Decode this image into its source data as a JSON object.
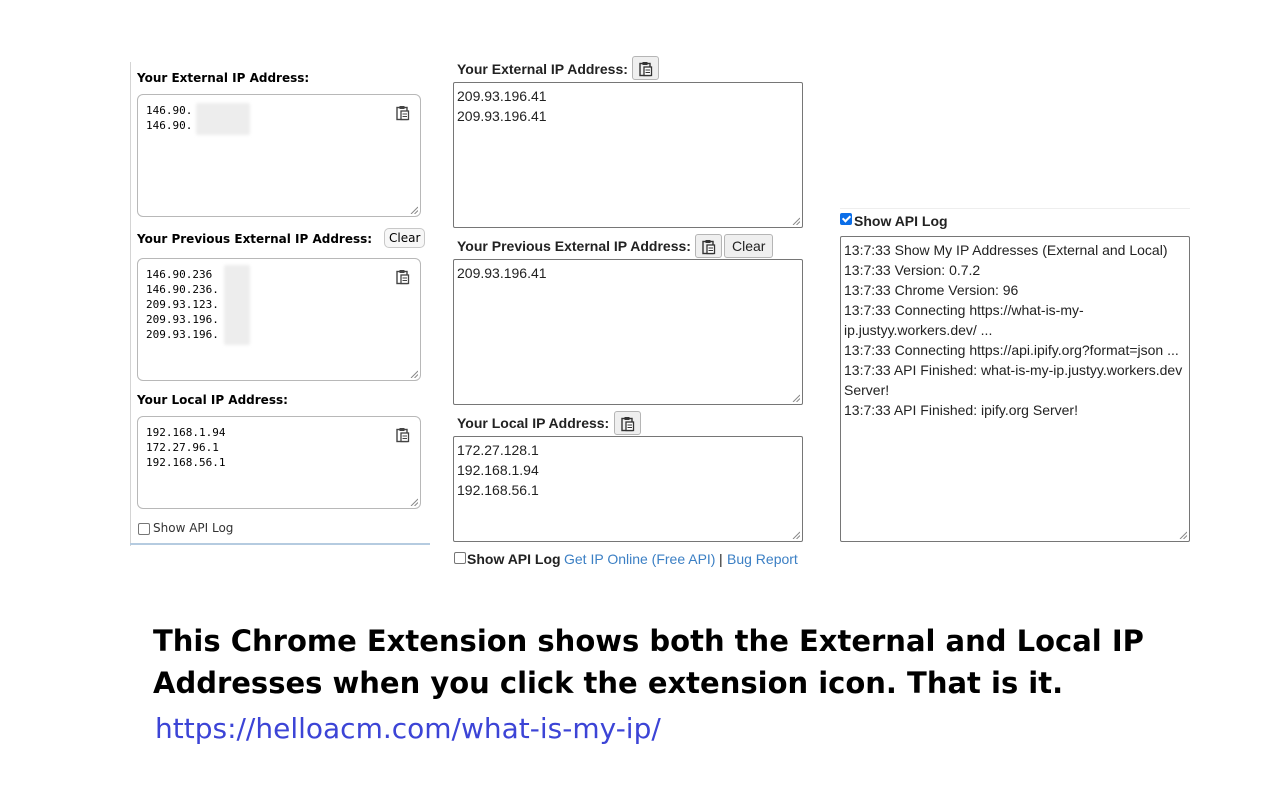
{
  "left_panel": {
    "external_label": "Your External IP Address:",
    "external_ips": [
      "146.90.",
      "146.90."
    ],
    "previous_label": "Your Previous External IP Address:",
    "clear_label": "Clear",
    "previous_ips": [
      "146.90.236",
      "146.90.236.",
      "209.93.123.",
      "209.93.196.",
      "209.93.196."
    ],
    "local_label": "Your Local IP Address:",
    "local_ips": [
      "192.168.1.94",
      "172.27.96.1",
      "192.168.56.1"
    ],
    "show_api_log_label": "Show API Log"
  },
  "middle_panel": {
    "external_label": "Your External IP Address:",
    "external_ips": [
      "209.93.196.41",
      "209.93.196.41"
    ],
    "previous_label": "Your Previous External IP Address:",
    "clear_label": "Clear",
    "previous_ips": [
      "209.93.196.41"
    ],
    "local_label": "Your Local IP Address:",
    "local_ips": [
      "172.27.128.1",
      "192.168.1.94",
      "192.168.56.1"
    ],
    "show_api_log_label": "Show API Log",
    "get_ip_link": "Get IP Online (Free API)",
    "separator": "|",
    "bug_report_link": "Bug Report"
  },
  "right_panel": {
    "show_api_log_label": "Show API Log",
    "show_api_log_checked": true,
    "log_lines": [
      "13:7:33 Show My IP Addresses (External and Local)",
      "13:7:33 Version: 0.7.2",
      "13:7:33 Chrome Version: 96",
      "13:7:33 Connecting https://what-is-my-",
      "ip.justyy.workers.dev/ ...",
      "13:7:33 Connecting https://api.ipify.org?format=json ...",
      "13:7:33 API Finished: what-is-my-ip.justyy.workers.dev",
      "Server!",
      "13:7:33 API Finished: ipify.org Server!"
    ]
  },
  "caption": {
    "line1": "This Chrome Extension shows both the External and Local IP",
    "line2": "Addresses when you click the extension icon. That is it.",
    "url": "https://helloacm.com/what-is-my-ip/"
  },
  "colors": {
    "link": "#3b7fc4",
    "caption_link": "#3c44d6",
    "checkbox_checked": "#0b6ee8"
  },
  "icons": {
    "copy": "clipboard-copy-icon",
    "resize": "resize-grip-icon"
  }
}
